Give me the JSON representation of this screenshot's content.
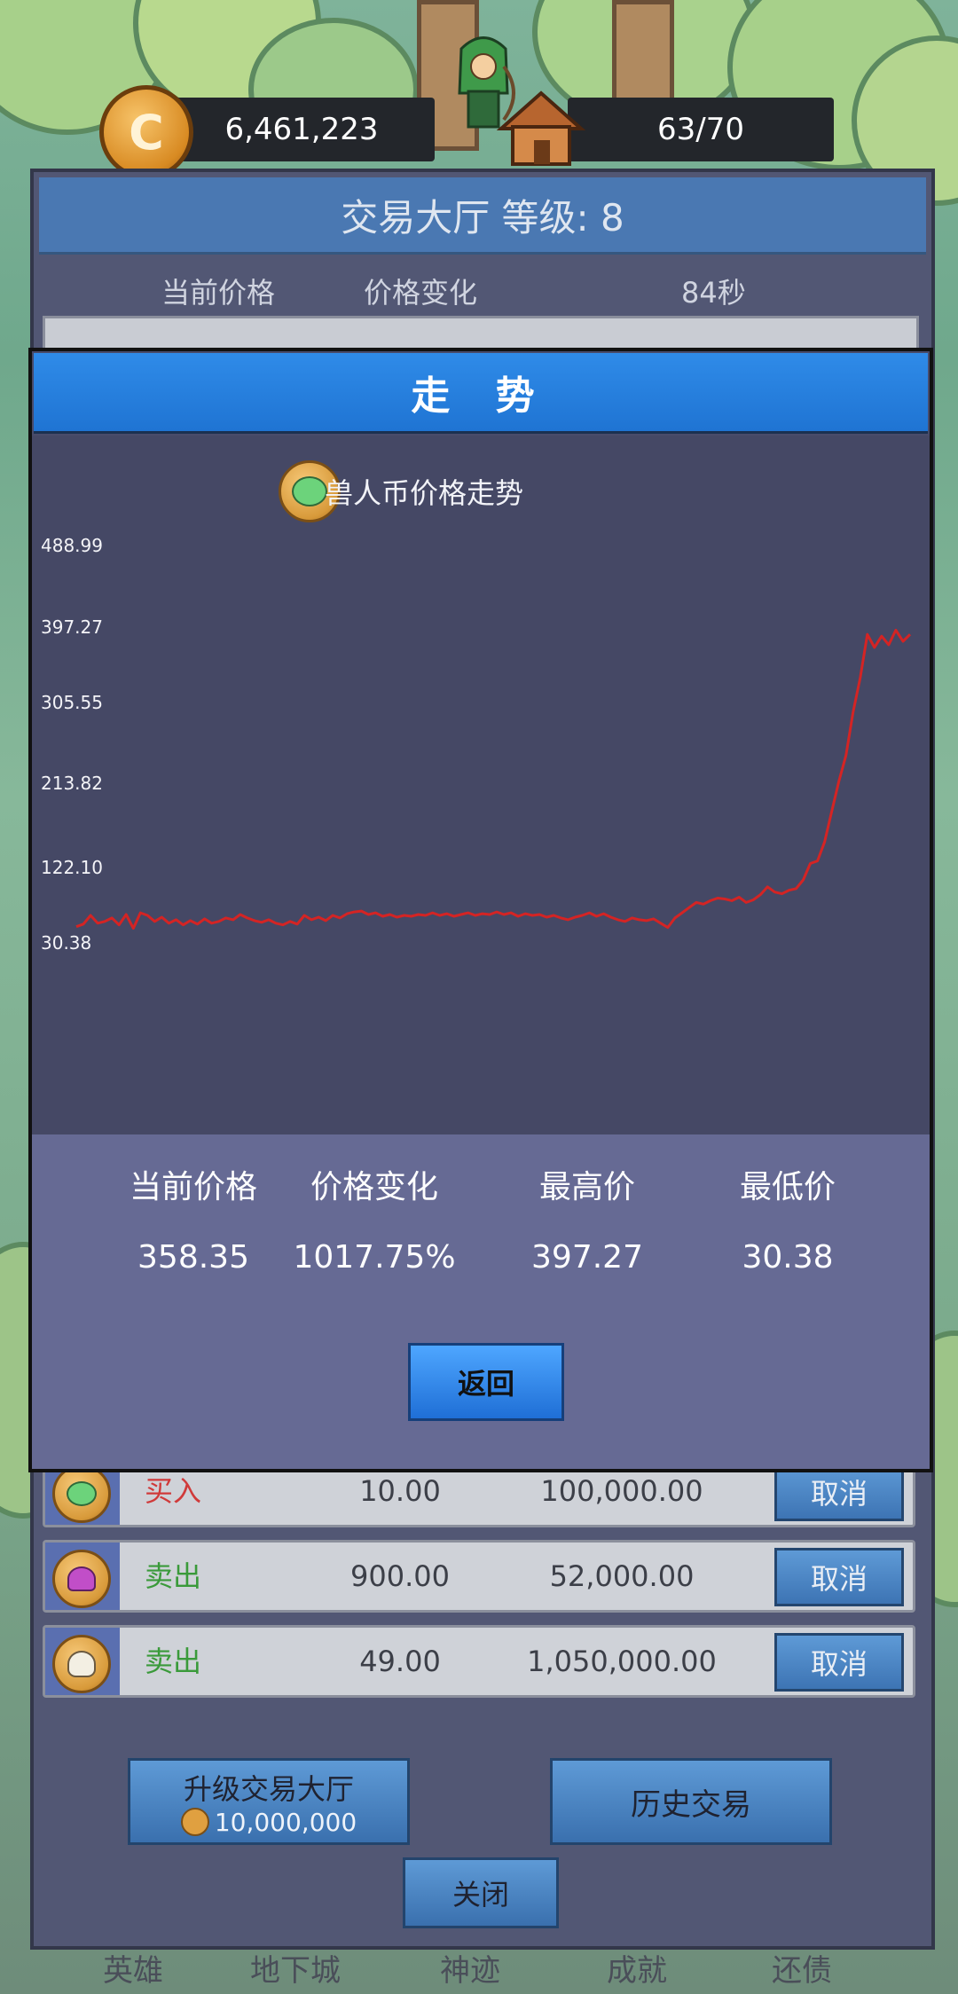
{
  "hud": {
    "coin_symbol": "C",
    "gold": "6,461,223",
    "capacity": "63/70"
  },
  "panel": {
    "title": "交易大厅 等级: 8",
    "col_current_price": "当前价格",
    "col_price_change": "价格变化",
    "timer": "84秒"
  },
  "orders": [
    {
      "type": "买入",
      "price": "10.00",
      "amount": "100,000.00",
      "cancel": "取消",
      "type_color": "#d03a3a",
      "icon": "orc-coin-icon"
    },
    {
      "type": "卖出",
      "price": "900.00",
      "amount": "52,000.00",
      "cancel": "取消",
      "type_color": "#3a9a3a",
      "icon": "mushroom-coin-icon"
    },
    {
      "type": "卖出",
      "price": "49.00",
      "amount": "1,050,000.00",
      "cancel": "取消",
      "type_color": "#3a9a3a",
      "icon": "skull-coin-icon"
    }
  ],
  "buttons": {
    "upgrade": "升级交易大厅",
    "upgrade_cost": "10,000,000",
    "history": "历史交易",
    "close": "关闭"
  },
  "tabs": [
    "英雄",
    "地下城",
    "神迹",
    "成就",
    "还债"
  ],
  "modal": {
    "title": "走 势",
    "back": "返回",
    "stats": {
      "current_label": "当前价格",
      "current_value": "358.35",
      "change_label": "价格变化",
      "change_value": "1017.75%",
      "high_label": "最高价",
      "high_value": "397.27",
      "low_label": "最低价",
      "low_value": "30.38"
    }
  },
  "chart_data": {
    "type": "line",
    "title": "兽人币价格走势",
    "ytick_labels": [
      "488.99",
      "397.27",
      "305.55",
      "213.82",
      "122.10",
      "30.38"
    ],
    "ylim": [
      30.38,
      488.99
    ],
    "line_color": "#d42424",
    "series": [
      {
        "values": [
          42,
          45,
          55,
          46,
          48,
          52,
          44,
          56,
          40,
          58,
          55,
          48,
          53,
          46,
          50,
          44,
          49,
          45,
          51,
          46,
          48,
          52,
          50,
          56,
          52,
          49,
          47,
          50,
          46,
          44,
          48,
          45,
          55,
          50,
          53,
          49,
          55,
          52,
          57,
          59,
          60,
          56,
          58,
          54,
          56,
          53,
          55,
          54,
          56,
          55,
          58,
          55,
          57,
          54,
          56,
          58,
          55,
          57,
          56,
          59,
          56,
          58,
          54,
          57,
          55,
          56,
          53,
          55,
          52,
          50,
          53,
          55,
          58,
          54,
          57,
          53,
          50,
          48,
          52,
          50,
          49,
          51,
          46,
          41,
          52,
          58,
          64,
          70,
          68,
          72,
          75,
          74,
          72,
          76,
          70,
          73,
          79,
          88,
          82,
          80,
          84,
          86,
          96,
          115,
          118,
          140,
          175,
          210,
          240,
          290,
          330,
          380,
          365,
          378,
          368,
          385,
          372,
          380
        ]
      }
    ]
  }
}
